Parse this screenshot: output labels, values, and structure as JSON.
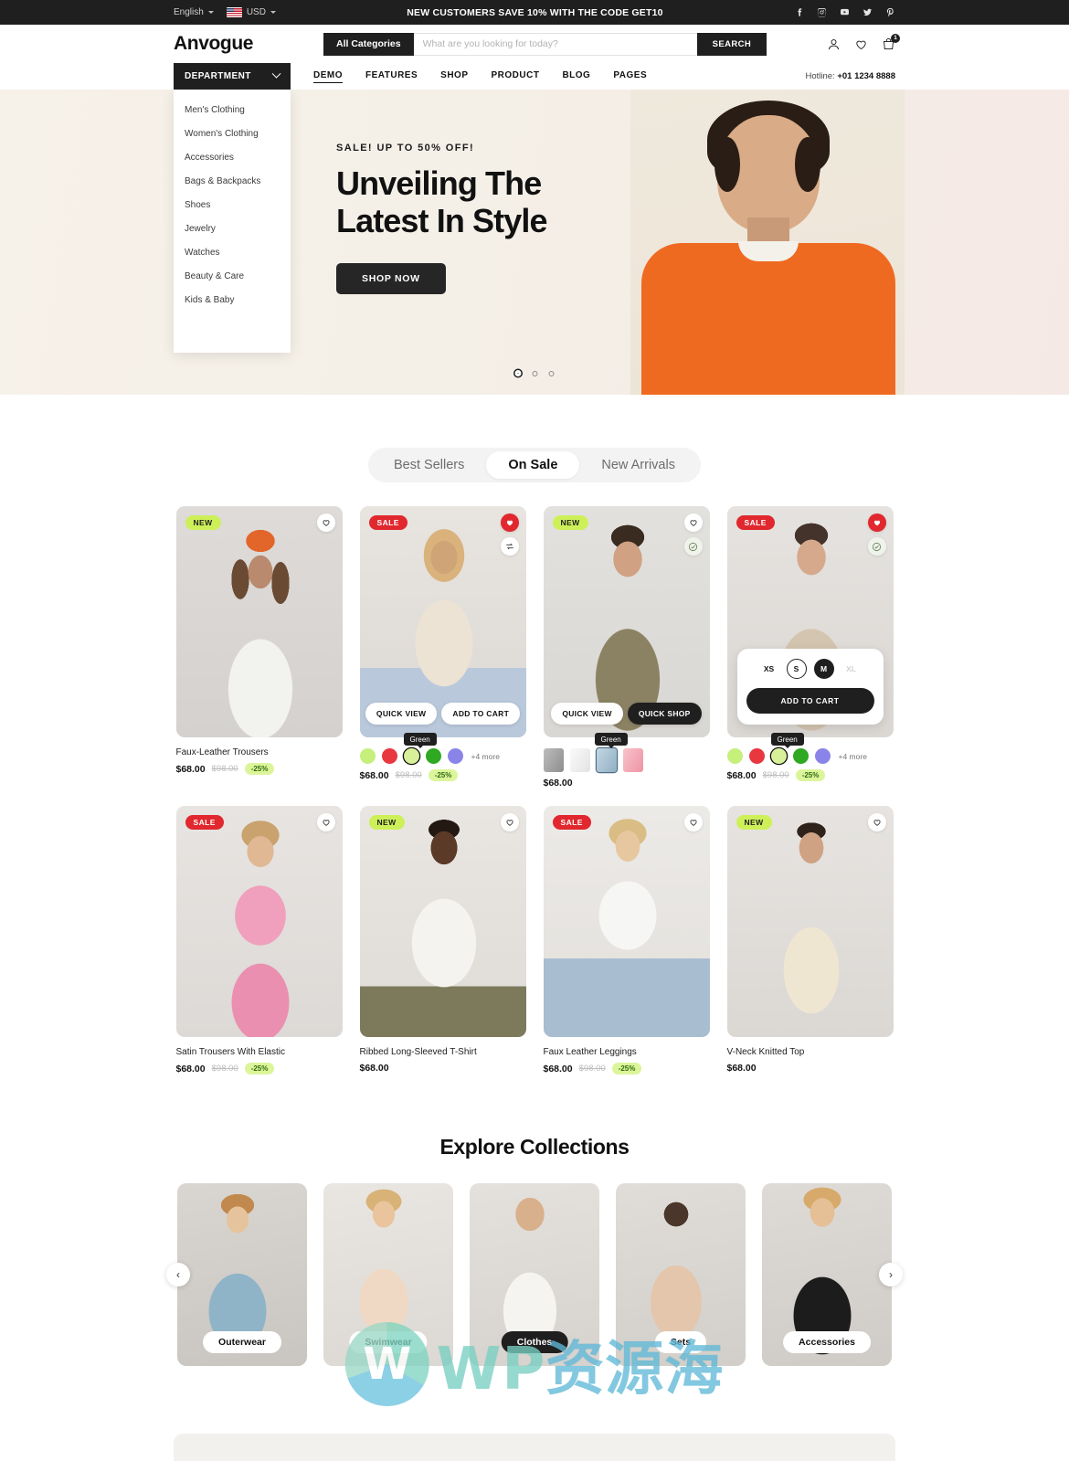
{
  "topbar": {
    "language": "English",
    "currency": "USD",
    "promo": "NEW CUSTOMERS SAVE 10% WITH THE CODE GET10",
    "socials": [
      {
        "name": "facebook-icon",
        "label": "Facebook"
      },
      {
        "name": "instagram-icon",
        "label": "Instagram"
      },
      {
        "name": "youtube-icon",
        "label": "YouTube"
      },
      {
        "name": "twitter-icon",
        "label": "Twitter"
      },
      {
        "name": "pinterest-icon",
        "label": "Pinterest"
      }
    ]
  },
  "header": {
    "logo": "Anvogue",
    "all_categories": "All Categories",
    "search_placeholder": "What are you looking for today?",
    "search_value": "",
    "search_button": "SEARCH",
    "cart_count": "1"
  },
  "nav": {
    "department_label": "DEPARTMENT",
    "items": [
      {
        "label": "DEMO",
        "active": true
      },
      {
        "label": "FEATURES",
        "active": false
      },
      {
        "label": "SHOP",
        "active": false
      },
      {
        "label": "PRODUCT",
        "active": false
      },
      {
        "label": "BLOG",
        "active": false
      },
      {
        "label": "PAGES",
        "active": false
      }
    ],
    "hotline_label": "Hotline:",
    "hotline_number": "+01 1234 8888"
  },
  "department_menu": [
    "Men's Clothing",
    "Women's Clothing",
    "Accessories",
    "Bags & Backpacks",
    "Shoes",
    "Jewelry",
    "Watches",
    "Beauty & Care",
    "Kids & Baby"
  ],
  "hero": {
    "kicker": "SALE! UP TO 50% OFF!",
    "title_line1": "Unveiling The",
    "title_line2": "Latest In Style",
    "cta": "SHOP NOW",
    "slide_count": 3,
    "active_slide": 1
  },
  "product_tabs": [
    {
      "label": "Best Sellers",
      "active": false
    },
    {
      "label": "On Sale",
      "active": true
    },
    {
      "label": "New Arrivals",
      "active": false
    }
  ],
  "products": [
    {
      "name": "Faux-Leather Trousers",
      "badge": "NEW",
      "badge_type": "new",
      "price": "$68.00",
      "old_price": "$98.00",
      "discount": "-25%",
      "wishlisted": false,
      "image_style": "woman-orange-headscarf-white-tee"
    },
    {
      "name": "",
      "badge": "SALE",
      "badge_type": "sale",
      "price": "$68.00",
      "old_price": "$98.00",
      "discount": "-25%",
      "wishlisted": true,
      "hover_buttons": [
        "QUICK VIEW",
        "ADD TO CART"
      ],
      "swatch_tooltip": "Green",
      "swatch_more": "+4 more",
      "swatches": [
        "#c6ef7c",
        "#e8373f",
        "#d8f09a",
        "#2fa822",
        "#8b84e8"
      ],
      "selected_swatch": 2,
      "image_style": "woman-crochet-top-jeans"
    },
    {
      "name": "",
      "badge": "NEW",
      "badge_type": "new",
      "price": "$68.00",
      "old_price": "",
      "discount": "",
      "wishlisted": false,
      "hover_buttons": [
        "QUICK VIEW",
        "QUICK SHOP"
      ],
      "swatch_tooltip": "Green",
      "swatch_images": [
        "#9b9b9b",
        "#efefef",
        "#a9c3d2",
        "#f0a9b4"
      ],
      "selected_swatch": 2,
      "image_style": "man-olive-tee"
    },
    {
      "name": "",
      "badge": "SALE",
      "badge_type": "sale",
      "price": "$68.00",
      "old_price": "$98.00",
      "discount": "-25%",
      "wishlisted": true,
      "sizes": [
        {
          "label": "XS",
          "state": "normal"
        },
        {
          "label": "S",
          "state": "outlined"
        },
        {
          "label": "M",
          "state": "selected"
        },
        {
          "label": "XL",
          "state": "disabled"
        }
      ],
      "add_to_cart": "ADD TO CART",
      "swatch_tooltip": "Green",
      "swatch_more": "+4 more",
      "swatches": [
        "#c6ef7c",
        "#e8373f",
        "#d8f09a",
        "#2fa822",
        "#8b84e8"
      ],
      "selected_swatch": 2,
      "image_style": "man-beige-tee"
    },
    {
      "name": "Satin Trousers With Elastic",
      "badge": "SALE",
      "badge_type": "sale",
      "price": "$68.00",
      "old_price": "$98.00",
      "discount": "-25%",
      "wishlisted": false,
      "image_style": "woman-pink-set"
    },
    {
      "name": "Ribbed Long-Sleeved T-Shirt",
      "badge": "NEW",
      "badge_type": "new",
      "price": "$68.00",
      "old_price": "",
      "discount": "",
      "wishlisted": false,
      "image_style": "man-white-henley"
    },
    {
      "name": "Faux Leather Leggings",
      "badge": "SALE",
      "badge_type": "sale",
      "price": "$68.00",
      "old_price": "$98.00",
      "discount": "-25%",
      "wishlisted": false,
      "image_style": "woman-white-tee-jeans"
    },
    {
      "name": "V-Neck Knitted Top",
      "badge": "NEW",
      "badge_type": "new",
      "price": "$68.00",
      "old_price": "",
      "discount": "",
      "wishlisted": false,
      "image_style": "woman-cream-cami"
    }
  ],
  "collections": {
    "title": "Explore Collections",
    "prev_icon": "chevron-left-icon",
    "next_icon": "chevron-right-icon",
    "items": [
      {
        "label": "Outerwear",
        "active": false
      },
      {
        "label": "Swimwear",
        "active": false
      },
      {
        "label": "Clothes",
        "active": true
      },
      {
        "label": "Sets",
        "active": false
      },
      {
        "label": "Accessories",
        "active": false
      }
    ]
  },
  "watermark": {
    "glyph": "W",
    "text_a": "WP",
    "text_b": "资源海"
  }
}
